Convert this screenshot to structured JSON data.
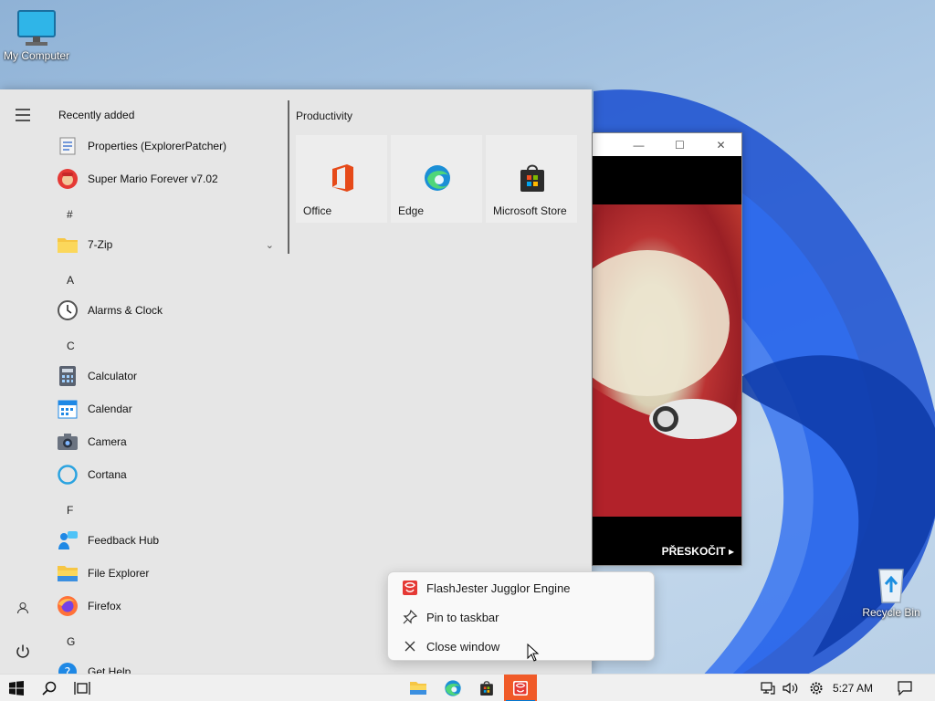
{
  "desktop": {
    "icons": [
      {
        "label": "My Computer",
        "icon": "monitor-icon"
      },
      {
        "label": "Recycle Bin",
        "icon": "recycle-bin-icon"
      }
    ]
  },
  "background_window": {
    "skip_label": "PŘESKOČIT ▸"
  },
  "start_menu": {
    "recently_added_title": "Recently added",
    "recent": [
      {
        "label": "Properties (ExplorerPatcher)",
        "icon": "properties-icon"
      },
      {
        "label": "Super Mario Forever v7.02",
        "icon": "mario-icon"
      }
    ],
    "groups": [
      {
        "letter": "#",
        "apps": [
          {
            "label": "7-Zip",
            "icon": "folder-icon",
            "expandable": true
          }
        ]
      },
      {
        "letter": "A",
        "apps": [
          {
            "label": "Alarms & Clock",
            "icon": "clock-icon"
          }
        ]
      },
      {
        "letter": "C",
        "apps": [
          {
            "label": "Calculator",
            "icon": "calculator-icon"
          },
          {
            "label": "Calendar",
            "icon": "calendar-icon"
          },
          {
            "label": "Camera",
            "icon": "camera-icon"
          },
          {
            "label": "Cortana",
            "icon": "cortana-icon"
          }
        ]
      },
      {
        "letter": "F",
        "apps": [
          {
            "label": "Feedback Hub",
            "icon": "feedback-icon"
          },
          {
            "label": "File Explorer",
            "icon": "file-explorer-icon"
          },
          {
            "label": "Firefox",
            "icon": "firefox-icon"
          }
        ]
      },
      {
        "letter": "G",
        "apps": [
          {
            "label": "Get Help",
            "icon": "help-icon"
          }
        ]
      }
    ],
    "tiles_group_title": "Productivity",
    "tiles": [
      {
        "label": "Office",
        "icon": "office-icon"
      },
      {
        "label": "Edge",
        "icon": "edge-icon"
      },
      {
        "label": "Microsoft Store",
        "icon": "store-icon"
      }
    ]
  },
  "context_menu": {
    "items": [
      {
        "label": "FlashJester Jugglor Engine",
        "icon": "flashjester-icon"
      },
      {
        "label": "Pin to taskbar",
        "icon": "pin-icon"
      },
      {
        "label": "Close window",
        "icon": "close-icon"
      }
    ]
  },
  "taskbar": {
    "clock": "5:27 AM",
    "colors": {
      "active_app": "#f05a28",
      "accent": "#0078d4"
    }
  }
}
